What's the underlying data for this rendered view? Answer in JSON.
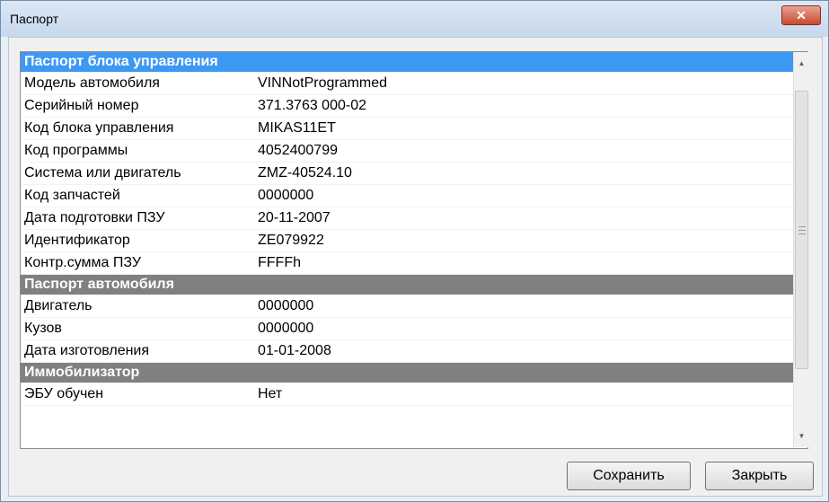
{
  "window": {
    "title": "Паспорт"
  },
  "grid": {
    "sections": [
      {
        "title": "Паспорт блока управления",
        "rows": [
          {
            "key": "Модель автомобиля",
            "value": "VINNotProgrammed"
          },
          {
            "key": "Серийный номер",
            "value": "371.3763 000-02"
          },
          {
            "key": "Код блока управления",
            "value": "MIKAS11ET"
          },
          {
            "key": "Код программы",
            "value": "4052400799"
          },
          {
            "key": "Система или двигатель",
            "value": "ZMZ-40524.10"
          },
          {
            "key": "Код запчастей",
            "value": "0000000"
          },
          {
            "key": "Дата подготовки ПЗУ",
            "value": "20-11-2007"
          },
          {
            "key": "Идентификатор",
            "value": "ZE079922"
          },
          {
            "key": "Контр.сумма ПЗУ",
            "value": "FFFFh"
          }
        ]
      },
      {
        "title": "Паспорт автомобиля",
        "rows": [
          {
            "key": "Двигатель",
            "value": "0000000"
          },
          {
            "key": "Кузов",
            "value": "0000000"
          },
          {
            "key": "Дата изготовления",
            "value": "01-01-2008"
          }
        ]
      },
      {
        "title": "Иммобилизатор",
        "rows": [
          {
            "key": "ЭБУ обучен",
            "value": "Нет"
          }
        ]
      }
    ]
  },
  "buttons": {
    "save": "Сохранить",
    "close": "Закрыть"
  },
  "colors": {
    "selected_section": "#3d98f4",
    "section": "#808080",
    "close_button": "#c8492f"
  },
  "icons": {
    "close": "close-icon",
    "scroll_up": "arrow-up-icon",
    "scroll_down": "arrow-down-icon"
  }
}
